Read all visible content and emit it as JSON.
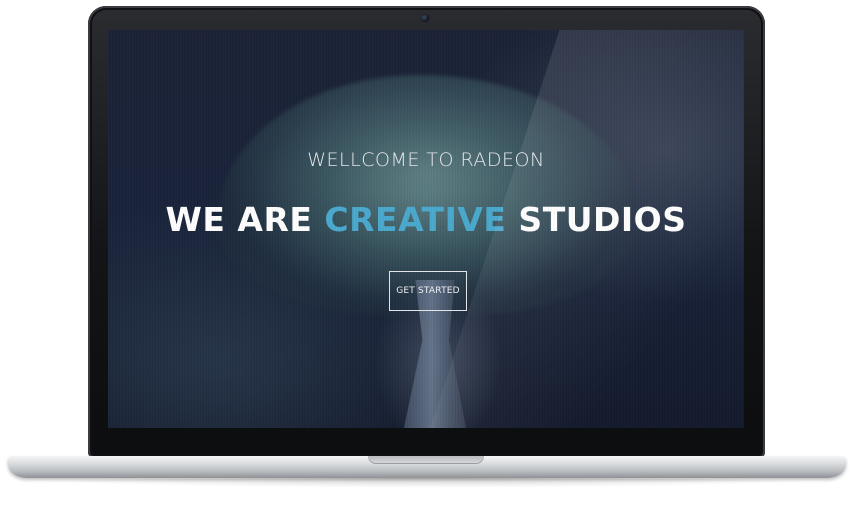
{
  "hero": {
    "welcome_text": "WELLCOME TO RADEON",
    "headline_part1": "WE ARE ",
    "headline_accent": "CREATIVE",
    "headline_part2": " STUDIOS",
    "cta_label": "GET STARTED"
  },
  "colors": {
    "accent": "#4aa9cf",
    "text_primary": "#ffffff",
    "background_dark": "#18223a"
  }
}
